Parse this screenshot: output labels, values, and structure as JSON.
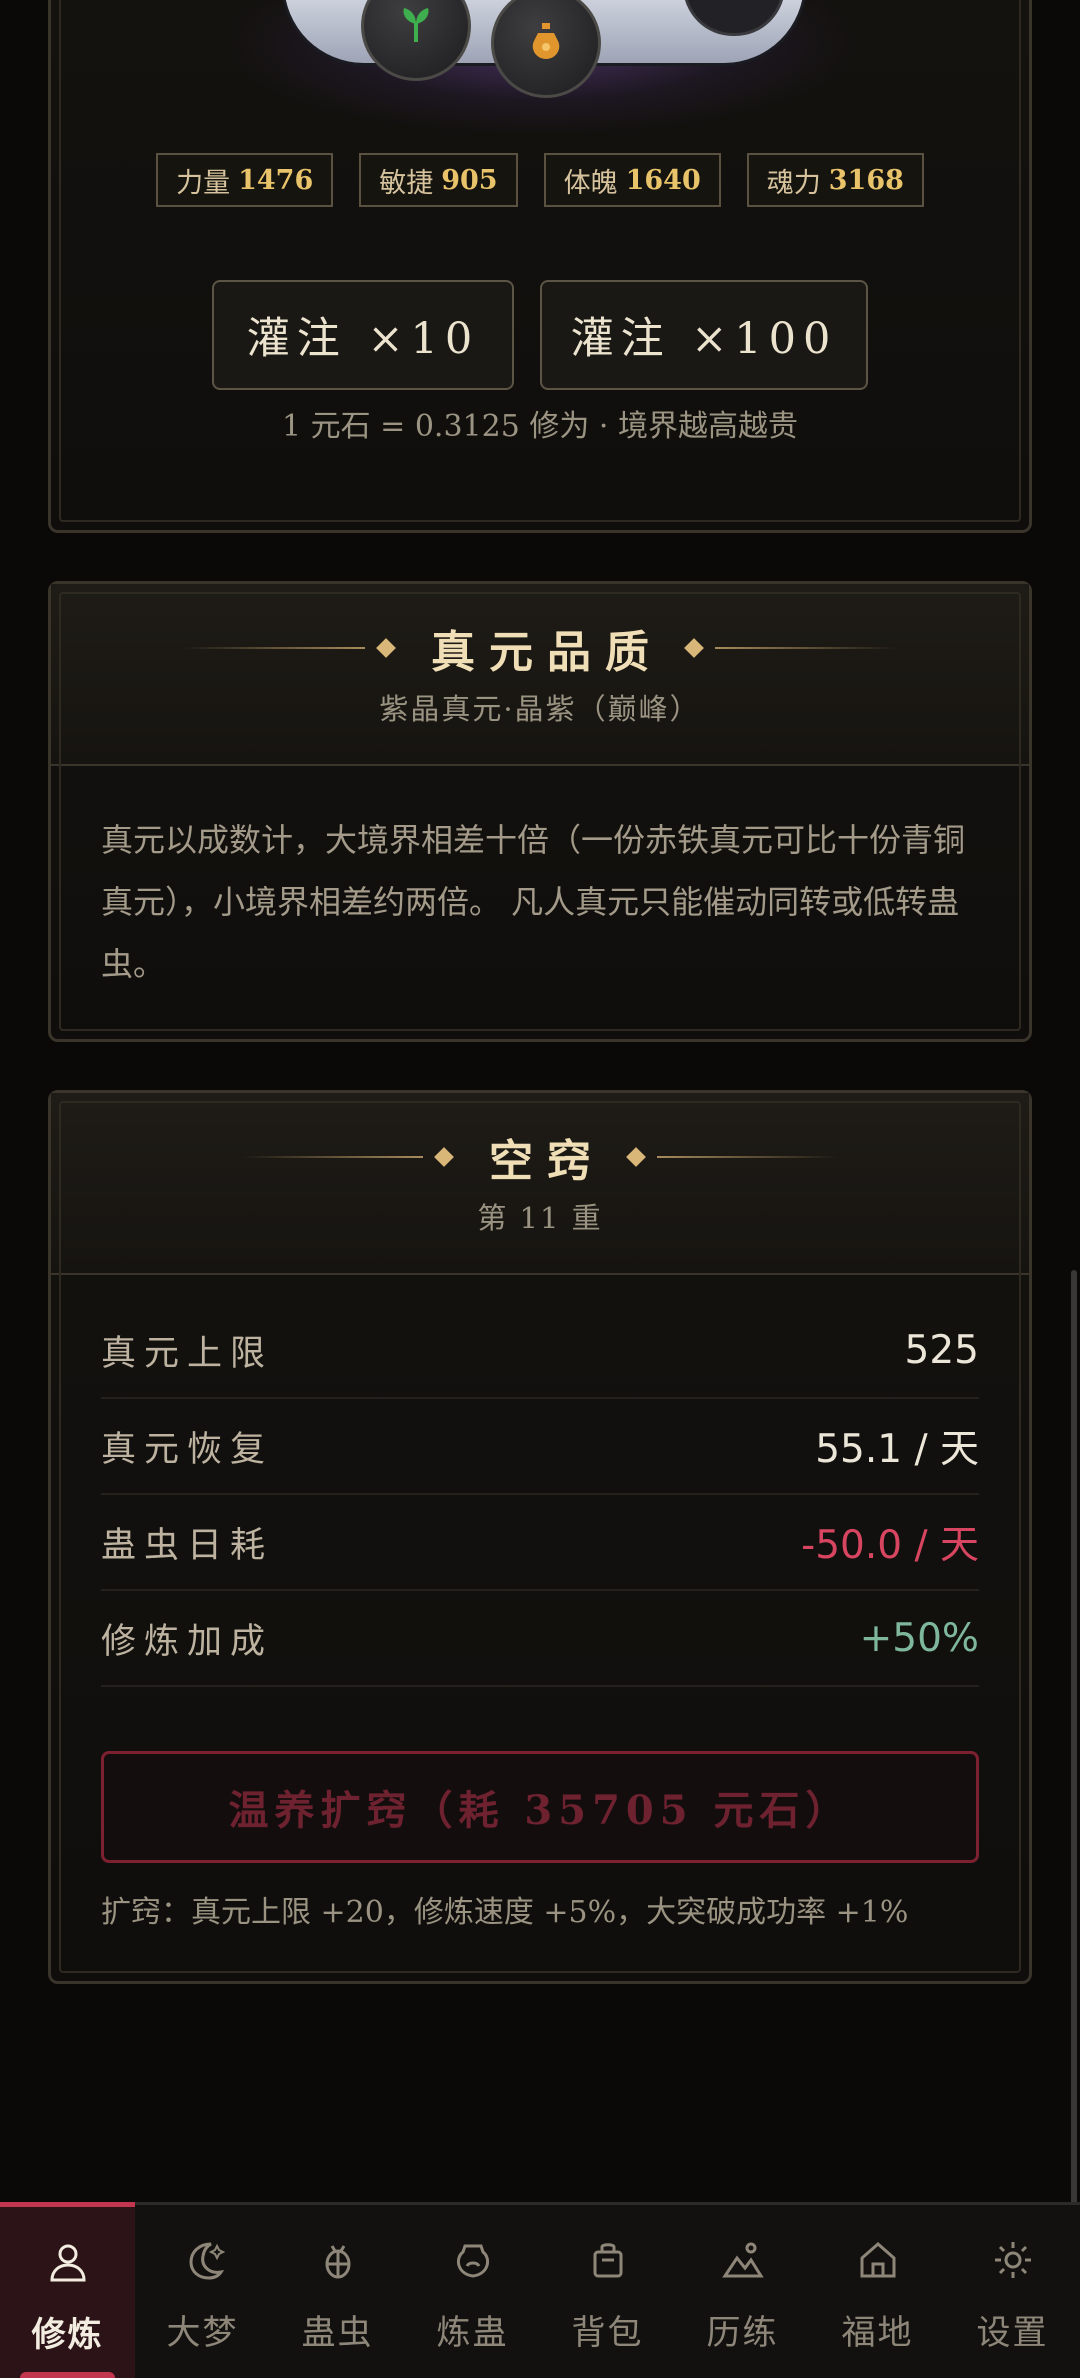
{
  "stats": [
    {
      "name": "力量",
      "value": "1476"
    },
    {
      "name": "敏捷",
      "value": "905"
    },
    {
      "name": "体魄",
      "value": "1640"
    },
    {
      "name": "魂力",
      "value": "3168"
    }
  ],
  "inject": {
    "btn10": "灌注 ×10",
    "btn100": "灌注 ×100",
    "rate_note": "1 元石 = 0.3125 修为 · 境界越高越贵"
  },
  "quality": {
    "title": "真元品质",
    "subtitle": "紫晶真元·晶紫（巅峰）",
    "description": "真元以成数计，大境界相差十倍（一份赤铁真元可比十份青铜真元），小境界相差约两倍。 凡人真元只能催动同转或低转蛊虫。"
  },
  "aperture": {
    "title": "空窍",
    "subtitle": "第 11 重",
    "rows": [
      {
        "label": "真元上限",
        "value": "525"
      },
      {
        "label": "真元恢复",
        "value": "55.1 / 天"
      },
      {
        "label": "蛊虫日耗",
        "value": "-50.0 / 天"
      },
      {
        "label": "修炼加成",
        "value": "+50%"
      }
    ],
    "warm_button": "温养扩窍（耗 35705 元石）",
    "expand_note": "扩窍：真元上限 +20，修炼速度 +5%，大突破成功率 +1%"
  },
  "nav": [
    {
      "label": "修炼",
      "icon": "person-icon"
    },
    {
      "label": "大梦",
      "icon": "moon-icon"
    },
    {
      "label": "蛊虫",
      "icon": "bug-icon"
    },
    {
      "label": "炼蛊",
      "icon": "cauldron-icon"
    },
    {
      "label": "背包",
      "icon": "bag-icon"
    },
    {
      "label": "历练",
      "icon": "mountain-icon"
    },
    {
      "label": "福地",
      "icon": "home-icon"
    },
    {
      "label": "设置",
      "icon": "gear-icon"
    }
  ],
  "colors": {
    "accent": "#c2364f",
    "gold": "#e8c36a",
    "negative": "#d74560",
    "positive": "#7fb79c"
  }
}
